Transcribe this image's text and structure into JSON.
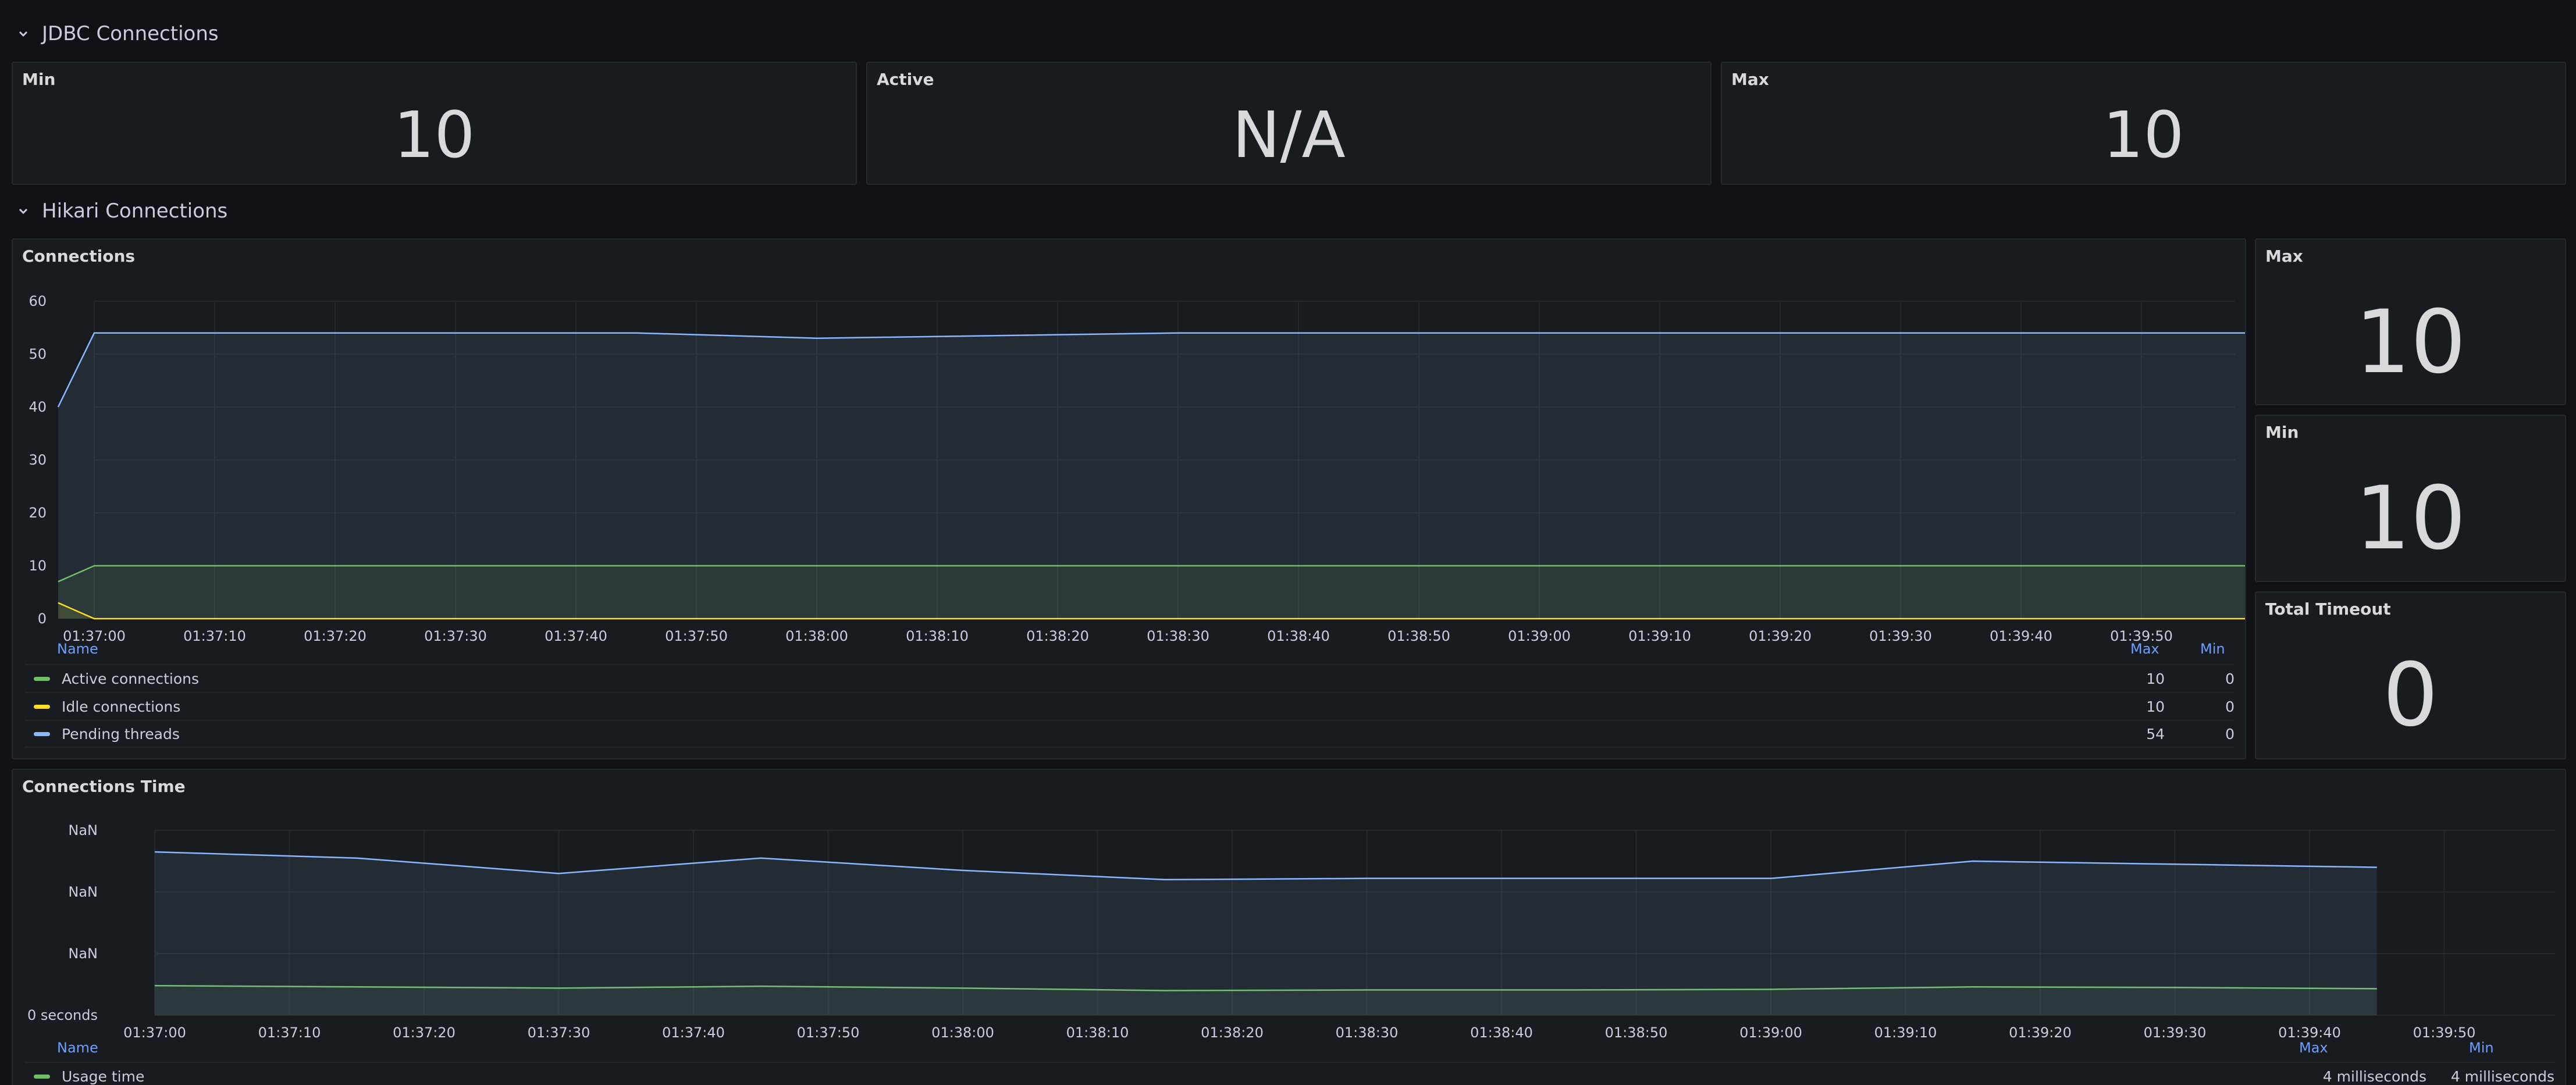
{
  "rows": {
    "jdbc": {
      "title": "JDBC Connections"
    },
    "hikari": {
      "title": "Hikari Connections"
    }
  },
  "jdbc_stats": [
    {
      "title": "Min",
      "value": "10"
    },
    {
      "title": "Active",
      "value": "N/A"
    },
    {
      "title": "Max",
      "value": "10"
    }
  ],
  "hikari_stats": [
    {
      "title": "Max",
      "value": "10"
    },
    {
      "title": "Min",
      "value": "10"
    },
    {
      "title": "Total Timeout",
      "value": "0"
    }
  ],
  "connections_panel": {
    "title": "Connections",
    "legend": {
      "name_header": "Name",
      "max_header": "Max",
      "min_header": "Min",
      "rows": [
        {
          "name": "Active connections",
          "max": "10",
          "min": "0",
          "color": "#73bf69"
        },
        {
          "name": "Idle connections",
          "max": "10",
          "min": "0",
          "color": "#fade2a"
        },
        {
          "name": "Pending threads",
          "max": "54",
          "min": "0",
          "color": "#8ab8ff"
        }
      ]
    }
  },
  "connections_time_panel": {
    "title": "Connections Time",
    "legend": {
      "name_header": "Name",
      "max_header": "Max",
      "min_header": "Min",
      "rows": [
        {
          "name": "Usage time",
          "max": "4 milliseconds",
          "min": "4 milliseconds",
          "color": "#73bf69"
        }
      ]
    }
  },
  "chart_data": [
    {
      "type": "area",
      "title": "Connections",
      "x": [
        "01:37:00",
        "01:37:10",
        "01:37:20",
        "01:37:30",
        "01:37:40",
        "01:37:50",
        "01:38:00",
        "01:38:10",
        "01:38:20",
        "01:38:30",
        "01:38:40",
        "01:38:50",
        "01:39:00",
        "01:39:10",
        "01:39:20",
        "01:39:30",
        "01:39:40",
        "01:39:50"
      ],
      "y_ticks": [
        "0",
        "10",
        "20",
        "30",
        "40",
        "50",
        "60"
      ],
      "ylim": [
        0,
        60
      ],
      "grid": true,
      "legend_position": "bottom",
      "series": [
        {
          "name": "Pending threads",
          "color": "#8ab8ff",
          "points": [
            [
              -3,
              40
            ],
            [
              0,
              54
            ],
            [
              30,
              54
            ],
            [
              45,
              54
            ],
            [
              60,
              53
            ],
            [
              90,
              54
            ],
            [
              120,
              54
            ],
            [
              150,
              54
            ],
            [
              180,
              54
            ],
            [
              210,
              54
            ],
            [
              240,
              54
            ],
            [
              270,
              54
            ],
            [
              300,
              54
            ],
            [
              330,
              53
            ],
            [
              345,
              53
            ],
            [
              355,
              53
            ]
          ]
        },
        {
          "name": "Active connections",
          "color": "#73bf69",
          "points": [
            [
              -3,
              7
            ],
            [
              0,
              10
            ],
            [
              30,
              10
            ],
            [
              60,
              10
            ],
            [
              90,
              10
            ],
            [
              120,
              10
            ],
            [
              150,
              10
            ],
            [
              180,
              10
            ],
            [
              210,
              10
            ],
            [
              240,
              9
            ],
            [
              270,
              10
            ],
            [
              300,
              10
            ],
            [
              330,
              10
            ],
            [
              355,
              10
            ]
          ]
        },
        {
          "name": "Idle connections",
          "color": "#fade2a",
          "points": [
            [
              -3,
              3
            ],
            [
              0,
              0
            ],
            [
              30,
              0
            ],
            [
              60,
              0
            ],
            [
              90,
              0
            ],
            [
              120,
              0
            ],
            [
              150,
              0
            ],
            [
              180,
              0
            ],
            [
              210,
              0
            ],
            [
              240,
              1
            ],
            [
              270,
              0
            ],
            [
              300,
              0
            ],
            [
              330,
              1
            ],
            [
              355,
              0
            ]
          ]
        }
      ]
    },
    {
      "type": "area",
      "title": "Connections Time",
      "x": [
        "01:37:00",
        "01:37:10",
        "01:37:20",
        "01:37:30",
        "01:37:40",
        "01:37:50",
        "01:38:00",
        "01:38:10",
        "01:38:20",
        "01:38:30",
        "01:38:40",
        "01:38:50",
        "01:39:00",
        "01:39:10",
        "01:39:20",
        "01:39:30",
        "01:39:40",
        "01:39:50"
      ],
      "y_ticks": [
        "0 seconds",
        "NaN",
        "NaN",
        "NaN"
      ],
      "grid": true,
      "legend_position": "bottom",
      "series": [
        {
          "name": "Usage time",
          "color": "#73bf69",
          "points": [
            [
              0,
              0.48
            ],
            [
              15,
              0.46
            ],
            [
              30,
              0.44
            ],
            [
              45,
              0.47
            ],
            [
              60,
              0.44
            ],
            [
              75,
              0.4
            ],
            [
              90,
              0.41
            ],
            [
              105,
              0.41
            ],
            [
              120,
              0.42
            ],
            [
              135,
              0.46
            ],
            [
              150,
              0.45
            ],
            [
              165,
              0.43
            ]
          ]
        },
        {
          "name": "",
          "color": "#8ab8ff",
          "points": [
            [
              0,
              2.65
            ],
            [
              15,
              2.55
            ],
            [
              30,
              2.3
            ],
            [
              45,
              2.55
            ],
            [
              60,
              2.35
            ],
            [
              75,
              2.2
            ],
            [
              90,
              2.22
            ],
            [
              105,
              2.22
            ],
            [
              120,
              2.22
            ],
            [
              135,
              2.5
            ],
            [
              150,
              2.45
            ],
            [
              165,
              2.4
            ]
          ]
        }
      ]
    }
  ]
}
